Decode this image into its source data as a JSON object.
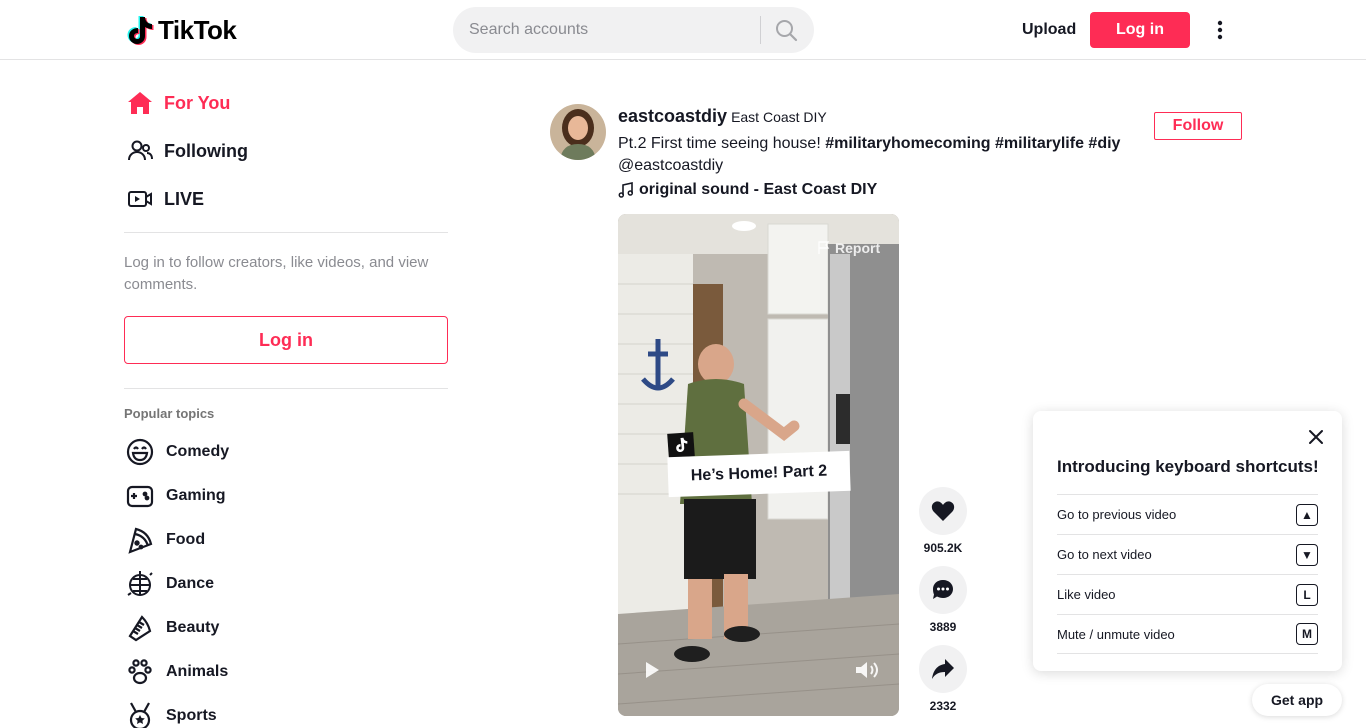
{
  "header": {
    "logo_text": "TikTok",
    "search_placeholder": "Search accounts",
    "upload_label": "Upload",
    "login_label": "Log in"
  },
  "sidebar": {
    "nav": [
      {
        "label": "For You",
        "icon": "home-icon",
        "active": true
      },
      {
        "label": "Following",
        "icon": "users-icon",
        "active": false
      },
      {
        "label": "LIVE",
        "icon": "live-icon",
        "active": false
      }
    ],
    "login_hint": "Log in to follow creators, like videos, and view comments.",
    "login_label": "Log in",
    "topics_title": "Popular topics",
    "topics": [
      {
        "label": "Comedy",
        "icon": "smile-icon"
      },
      {
        "label": "Gaming",
        "icon": "gamepad-icon"
      },
      {
        "label": "Food",
        "icon": "pizza-icon"
      },
      {
        "label": "Dance",
        "icon": "disco-ball-icon"
      },
      {
        "label": "Beauty",
        "icon": "comb-icon"
      },
      {
        "label": "Animals",
        "icon": "paw-icon"
      },
      {
        "label": "Sports",
        "icon": "medal-icon"
      }
    ]
  },
  "post": {
    "author_id": "eastcoastdiy",
    "author_nickname": "East Coast DIY",
    "caption_text": "Pt.2 First time seeing house! ",
    "hashtags": [
      "#militaryhomecoming",
      "#militarylife",
      "#diy"
    ],
    "mention": "@eastcoastdiy",
    "music": "original sound - East Coast DIY",
    "follow_label": "Follow",
    "report_label": "Report",
    "sticker_text": "He’s Home! Part 2",
    "likes": "905.2K",
    "comments": "3889",
    "shares": "2332"
  },
  "shortcuts": {
    "title": "Introducing keyboard shortcuts!",
    "items": [
      {
        "label": "Go to previous video",
        "key": "▲"
      },
      {
        "label": "Go to next video",
        "key": "▼"
      },
      {
        "label": "Like video",
        "key": "L"
      },
      {
        "label": "Mute / unmute video",
        "key": "M"
      }
    ]
  },
  "get_app_label": "Get app",
  "colors": {
    "accent": "#fe2c55",
    "text": "#161823",
    "muted": "#8a8b91",
    "divider": "#e3e3e4"
  }
}
